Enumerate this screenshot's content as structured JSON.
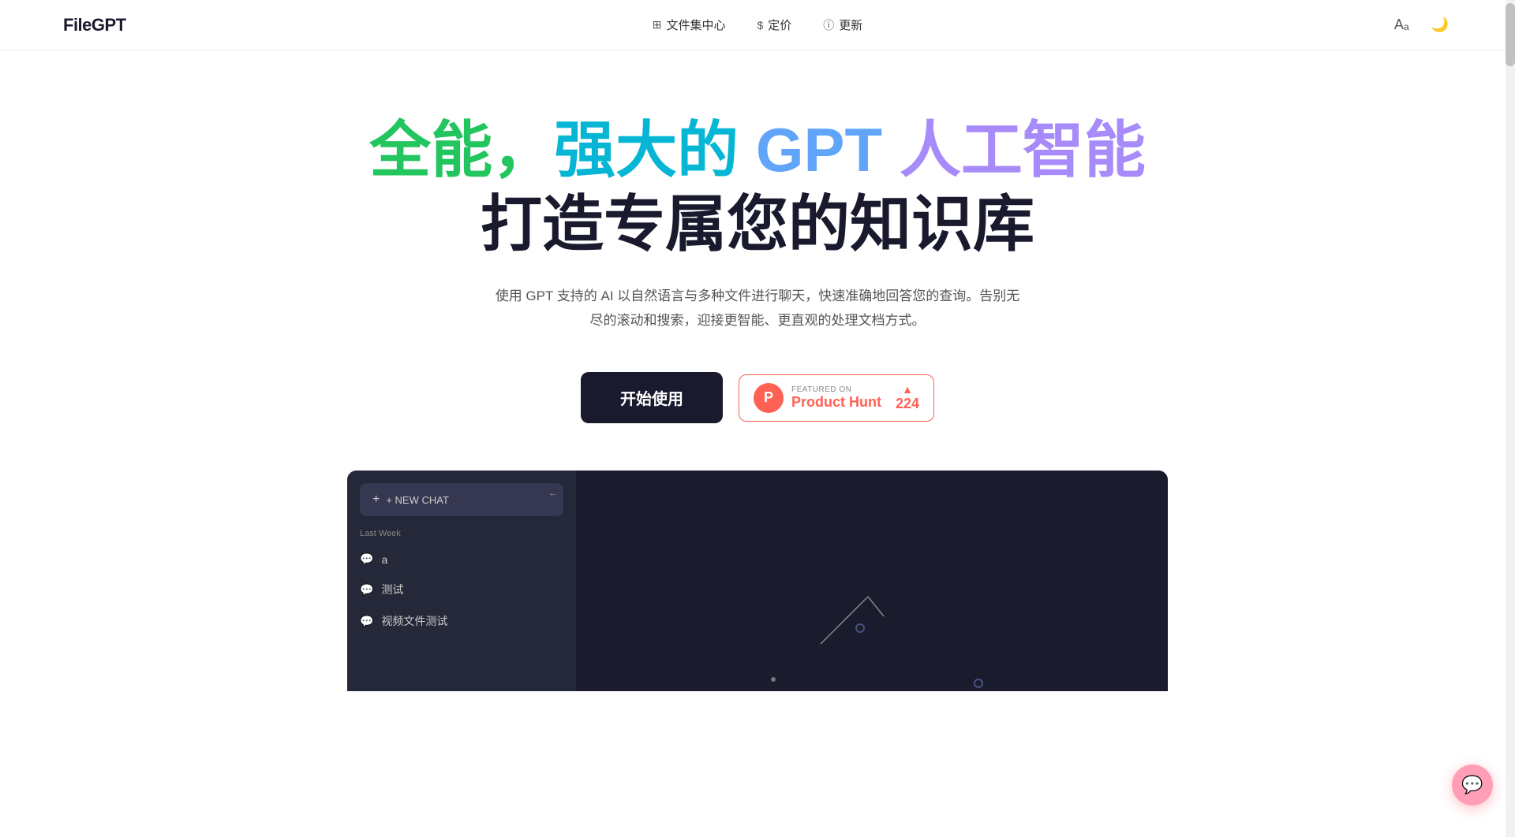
{
  "nav": {
    "logo": "FileGPT",
    "links": [
      {
        "id": "file-hub",
        "icon": "⊞",
        "label": "文件集中心"
      },
      {
        "id": "pricing",
        "icon": "$",
        "label": "定价"
      },
      {
        "id": "updates",
        "icon": "ⓘ",
        "label": "更新"
      }
    ],
    "lang_icon": "Aₐ",
    "theme_icon": "🌙"
  },
  "hero": {
    "title_part1": "全能，",
    "title_part2": "强大的",
    "title_part3": " GPT ",
    "title_part4": "人工智能",
    "title_part5": " 打造专属您的知识库",
    "subtitle": "使用 GPT 支持的 AI 以自然语言与多种文件进行聊天，快速准确地回答您的查询。告别无尽的滚动和搜索，迎接更智能、更直观的处理文档方式。",
    "start_button": "开始使用",
    "product_hunt": {
      "featured_on": "FEATURED ON",
      "name": "Product Hunt",
      "count": "224"
    }
  },
  "demo": {
    "new_chat": "+ NEW CHAT",
    "collapse_arrow": "←",
    "section_label": "Last Week",
    "chat_items": [
      {
        "label": "a"
      },
      {
        "label": "测试"
      },
      {
        "label": "视频文件测试"
      }
    ]
  },
  "colors": {
    "accent_green": "#22c55e",
    "accent_teal": "#06b6d4",
    "accent_blue": "#60a5fa",
    "accent_purple": "#a78bfa",
    "product_hunt_red": "#ff6154",
    "dark_bg": "#1a1a2e",
    "sidebar_bg": "#252838",
    "main_bg": "#1a1c2e"
  }
}
